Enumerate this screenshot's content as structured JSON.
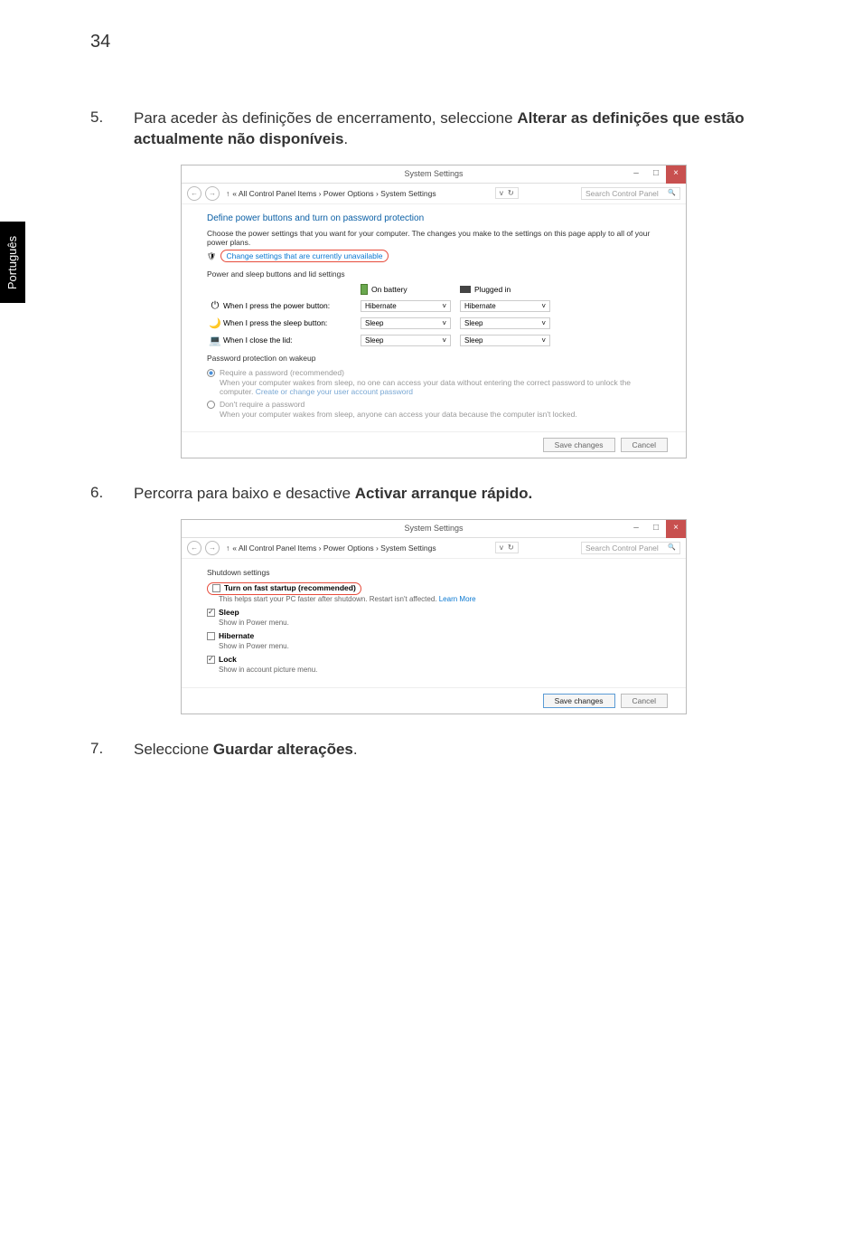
{
  "page_number": "34",
  "side_tab": "Português",
  "step5": {
    "num": "5.",
    "text_pre": "Para aceder às definições de encerramento, seleccione ",
    "bold": "Alterar as definições que estão actualmente não disponíveis",
    "period": "."
  },
  "step6": {
    "num": "6.",
    "text_pre": "Percorra para baixo e desactive ",
    "bold": "Activar arranque rápido.",
    "period": ""
  },
  "step7": {
    "num": "7.",
    "text_pre": "Seleccione ",
    "bold": "Guardar alterações",
    "period": "."
  },
  "win": {
    "title": "System Settings",
    "min": "–",
    "max": "□",
    "close": "×",
    "back": "←",
    "fwd": "→",
    "up": "↑",
    "breadcrumb": "« All Control Panel Items  ›  Power Options  ›  System Settings",
    "refresh": "↻",
    "search": "Search Control Panel",
    "mag": "🔍"
  },
  "panel1": {
    "hdr": "Define power buttons and turn on password protection",
    "desc": "Choose the power settings that you want for your computer. The changes you make to the settings on this page apply to all of your power plans.",
    "link": "Change settings that are currently unavailable",
    "section": "Power and sleep buttons and lid settings",
    "on_battery": "On battery",
    "plugged_in": "Plugged in",
    "r1_lbl": "When I press the power button:",
    "r1_v1": "Hibernate",
    "r1_v2": "Hibernate",
    "r2_lbl": "When I press the sleep button:",
    "r2_v1": "Sleep",
    "r2_v2": "Sleep",
    "r3_lbl": "When I close the lid:",
    "r3_v1": "Sleep",
    "r3_v2": "Sleep",
    "prot_hdr": "Password protection on wakeup",
    "req": "Require a password (recommended)",
    "req_desc1": "When your computer wakes from sleep, no one can access your data without entering the correct password to unlock the computer. ",
    "req_link": "Create or change your user account password",
    "dont": "Don't require a password",
    "dont_desc": "When your computer wakes from sleep, anyone can access your data because the computer isn't locked.",
    "save": "Save changes",
    "cancel": "Cancel"
  },
  "panel2": {
    "section": "Shutdown settings",
    "fast": "Turn on fast startup (recommended)",
    "fast_sub": "This helps start your PC faster after shutdown. Restart isn't affected. ",
    "learn": "Learn More",
    "sleep": "Sleep",
    "sleep_sub": "Show in Power menu.",
    "hib": "Hibernate",
    "hib_sub": "Show in Power menu.",
    "lock": "Lock",
    "lock_sub": "Show in account picture menu.",
    "save": "Save changes",
    "cancel": "Cancel"
  }
}
